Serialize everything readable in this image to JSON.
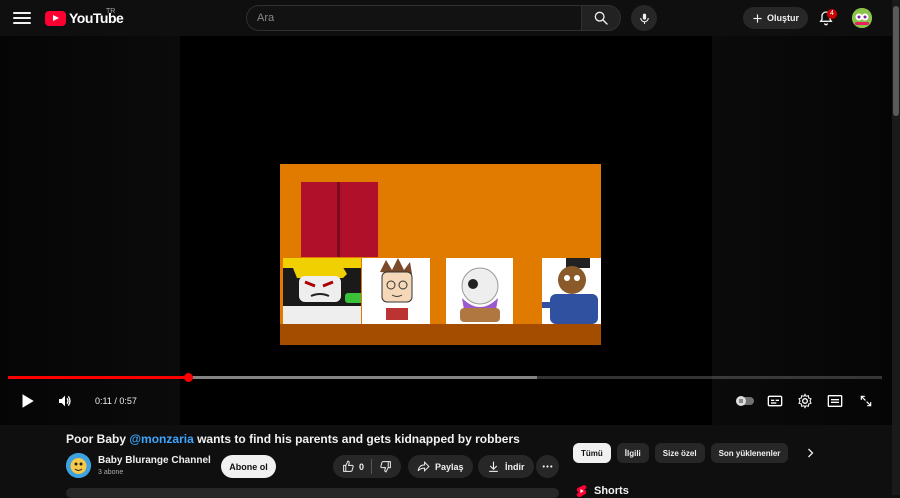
{
  "header": {
    "logo_text": "YouTube",
    "country_code": "TR",
    "search_placeholder": "Ara",
    "create_label": "Oluştur",
    "notification_count": "4"
  },
  "player": {
    "current_time": "0:11",
    "separator": " / ",
    "duration": "0:57",
    "played_fraction": 0.207,
    "buffered_fraction": 0.605
  },
  "video": {
    "title_prefix": "Poor Baby ",
    "title_mention": "@monzaria",
    "title_suffix": " wants to find his parents and gets kidnapped by robbers",
    "channel_name": "Baby Blurange Channel",
    "subscribers": "3 abone",
    "subscribe_label": "Abone ol",
    "like_count": "0",
    "share_label": "Paylaş",
    "download_label": "İndir"
  },
  "sidebar": {
    "chips": [
      "Tümü",
      "İlgili",
      "Size özel",
      "Son yüklenenler"
    ],
    "shorts_label": "Shorts"
  },
  "colors": {
    "accent": "#ff0000",
    "mention": "#3ea6ff",
    "background": "#0f0f0f"
  }
}
